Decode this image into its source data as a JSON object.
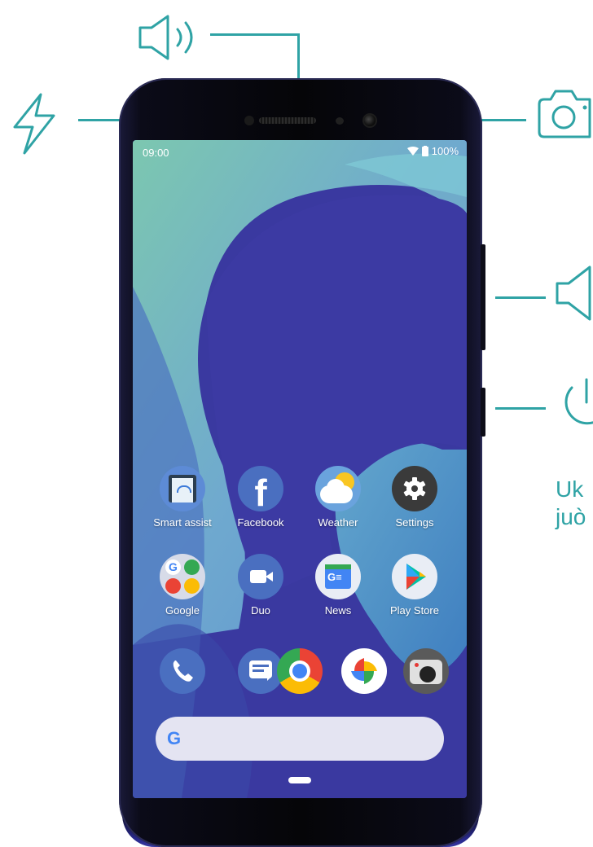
{
  "callouts": {
    "buttons_label_partial": "Uk\njuò"
  },
  "status_bar": {
    "time": "09:00",
    "battery": "100%"
  },
  "apps": [
    {
      "label": "Smart assist",
      "icon": "smart-assist-icon"
    },
    {
      "label": "Facebook",
      "icon": "facebook-icon"
    },
    {
      "label": "Weather",
      "icon": "weather-icon"
    },
    {
      "label": "Settings",
      "icon": "gear-icon"
    },
    {
      "label": "Google",
      "icon": "google-folder-icon"
    },
    {
      "label": "Duo",
      "icon": "duo-video-icon"
    },
    {
      "label": "News",
      "icon": "news-icon"
    },
    {
      "label": "Play Store",
      "icon": "play-store-icon"
    }
  ],
  "dock": [
    {
      "icon": "phone-icon"
    },
    {
      "icon": "messages-icon"
    },
    {
      "icon": "chrome-icon"
    },
    {
      "icon": "photos-icon"
    },
    {
      "icon": "camera-icon"
    }
  ],
  "search_bar": {
    "logo": "G"
  },
  "colors": {
    "callout_accent": "#2fa3a5",
    "wallpaper_base": "#3c3aa3",
    "wallpaper_light": "#6fc4cf"
  }
}
